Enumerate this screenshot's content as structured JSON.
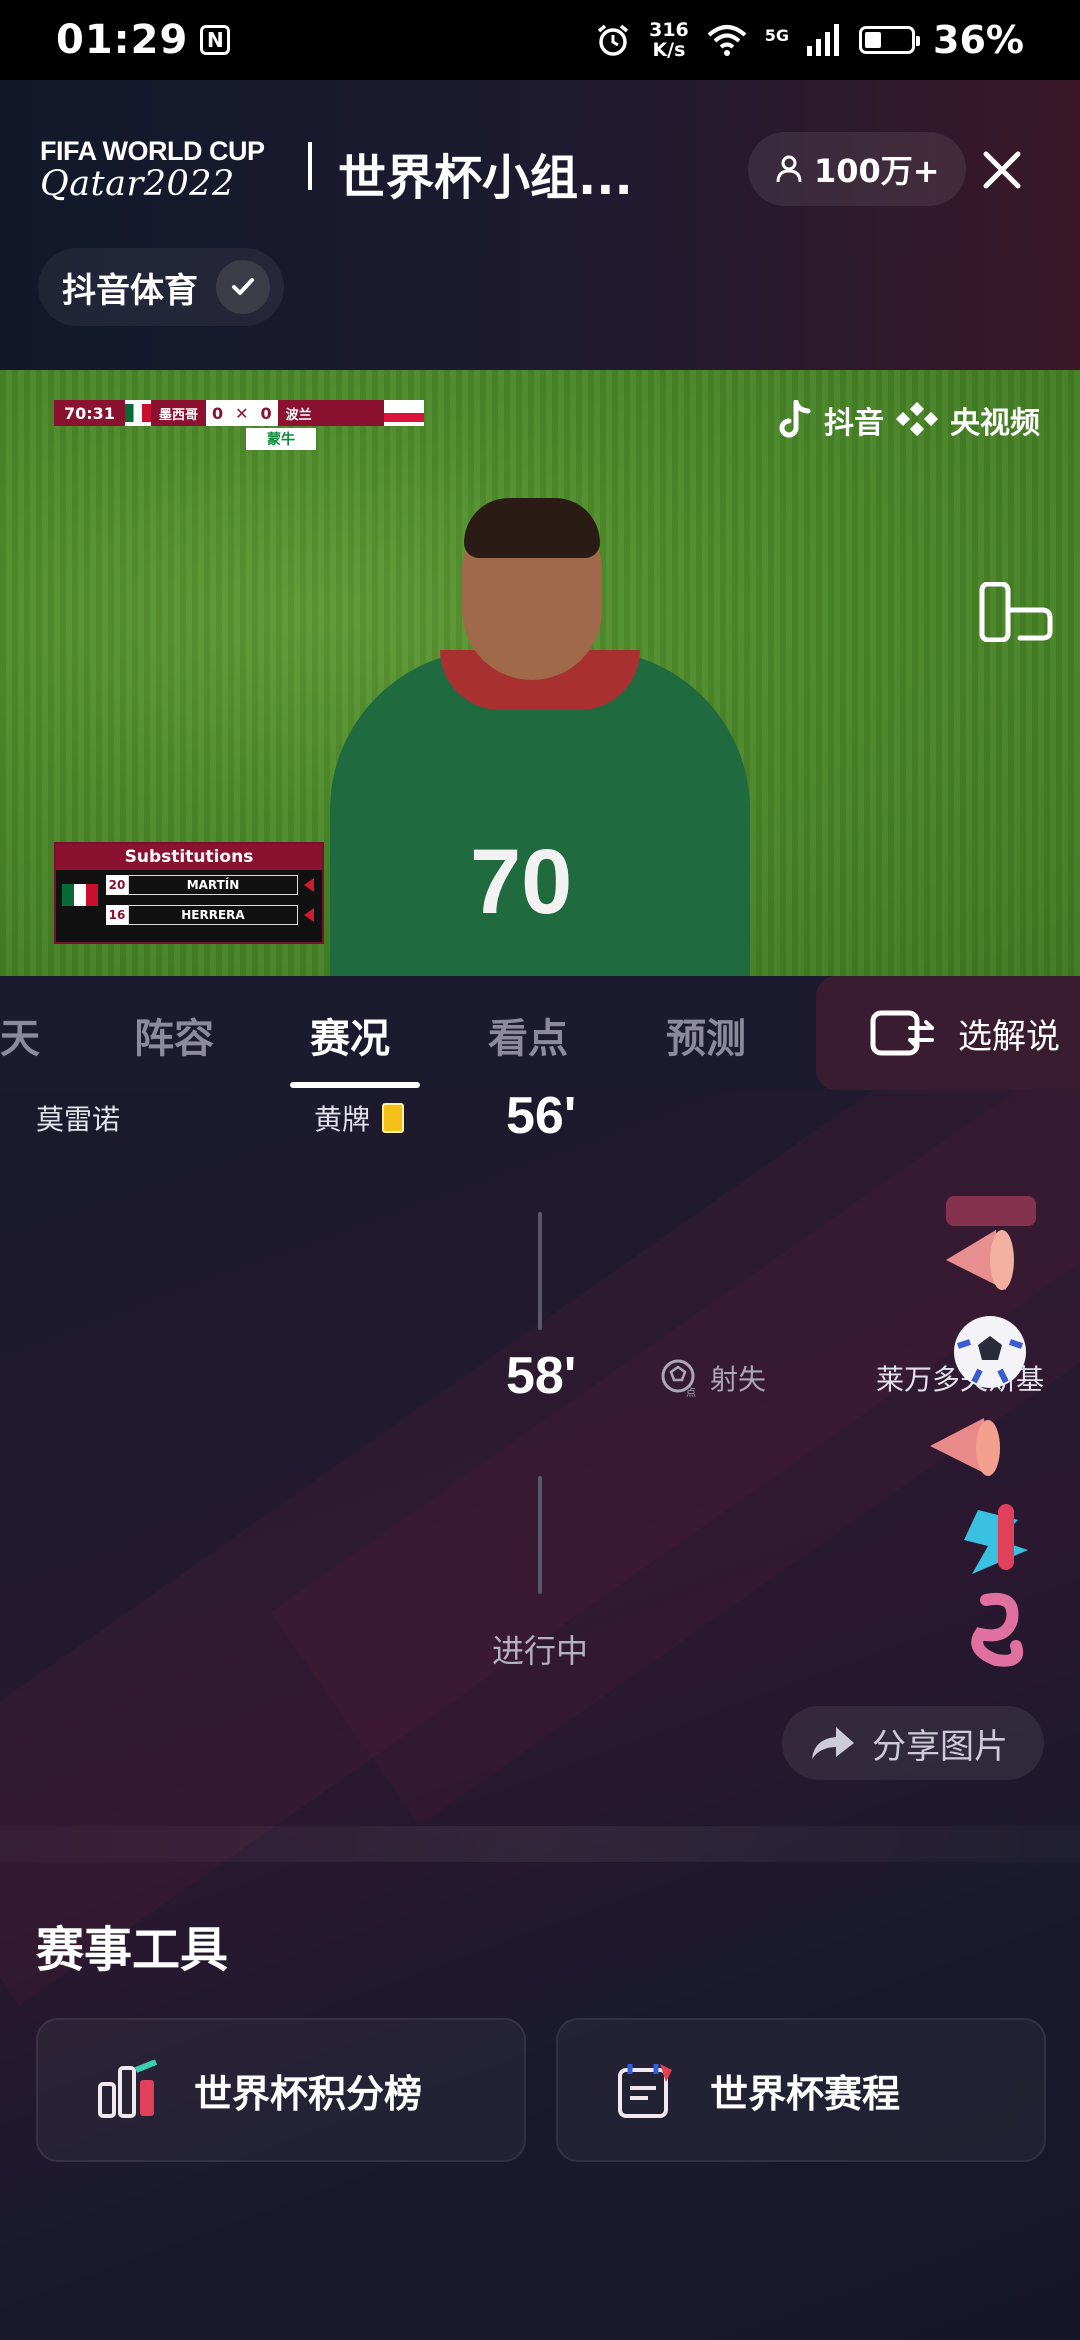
{
  "status_bar": {
    "time": "01:29",
    "nfc": "N",
    "net_speed_value": "316",
    "net_speed_unit": "K/s",
    "network": "5G",
    "battery_percent": "36%",
    "battery_level": 0.36
  },
  "header": {
    "logo_top": "FIFA WORLD CUP",
    "logo_bottom": "Qatar2022",
    "title": "世界杯小组...",
    "viewers": "100万+",
    "channel": "抖音体育"
  },
  "video": {
    "scorebug": {
      "time": "70:31",
      "home": "墨西哥",
      "home_score": "0",
      "away_score": "0",
      "away": "波兰",
      "sponsor": "蒙牛"
    },
    "watermark_1": "抖音",
    "watermark_2": "央视频",
    "player_number": "70",
    "substitutions": {
      "title": "Substitutions",
      "in_number": "20",
      "in_name": "MARTÍN",
      "out_number": "16",
      "out_name": "HERRERA"
    }
  },
  "tabs": {
    "items": [
      "天",
      "阵容",
      "赛况",
      "看点",
      "预测"
    ],
    "active_index": 2,
    "commentary_label": "选解说"
  },
  "events": [
    {
      "time": "56'",
      "side": "left",
      "player": "莫雷诺",
      "type": "黄牌"
    },
    {
      "time": "58'",
      "side": "right",
      "player": "莱万多夫斯基",
      "type": "射失"
    }
  ],
  "status_text": "进行中",
  "share_label": "分享图片",
  "tools": {
    "title": "赛事工具",
    "items": [
      {
        "label": "世界杯积分榜",
        "icon": "standings-chart-icon"
      },
      {
        "label": "世界杯赛程",
        "icon": "schedule-calendar-icon"
      }
    ]
  },
  "colors": {
    "accent_red": "#8a1230",
    "yellow_card": "#f4c11a",
    "background": "#15152a"
  }
}
